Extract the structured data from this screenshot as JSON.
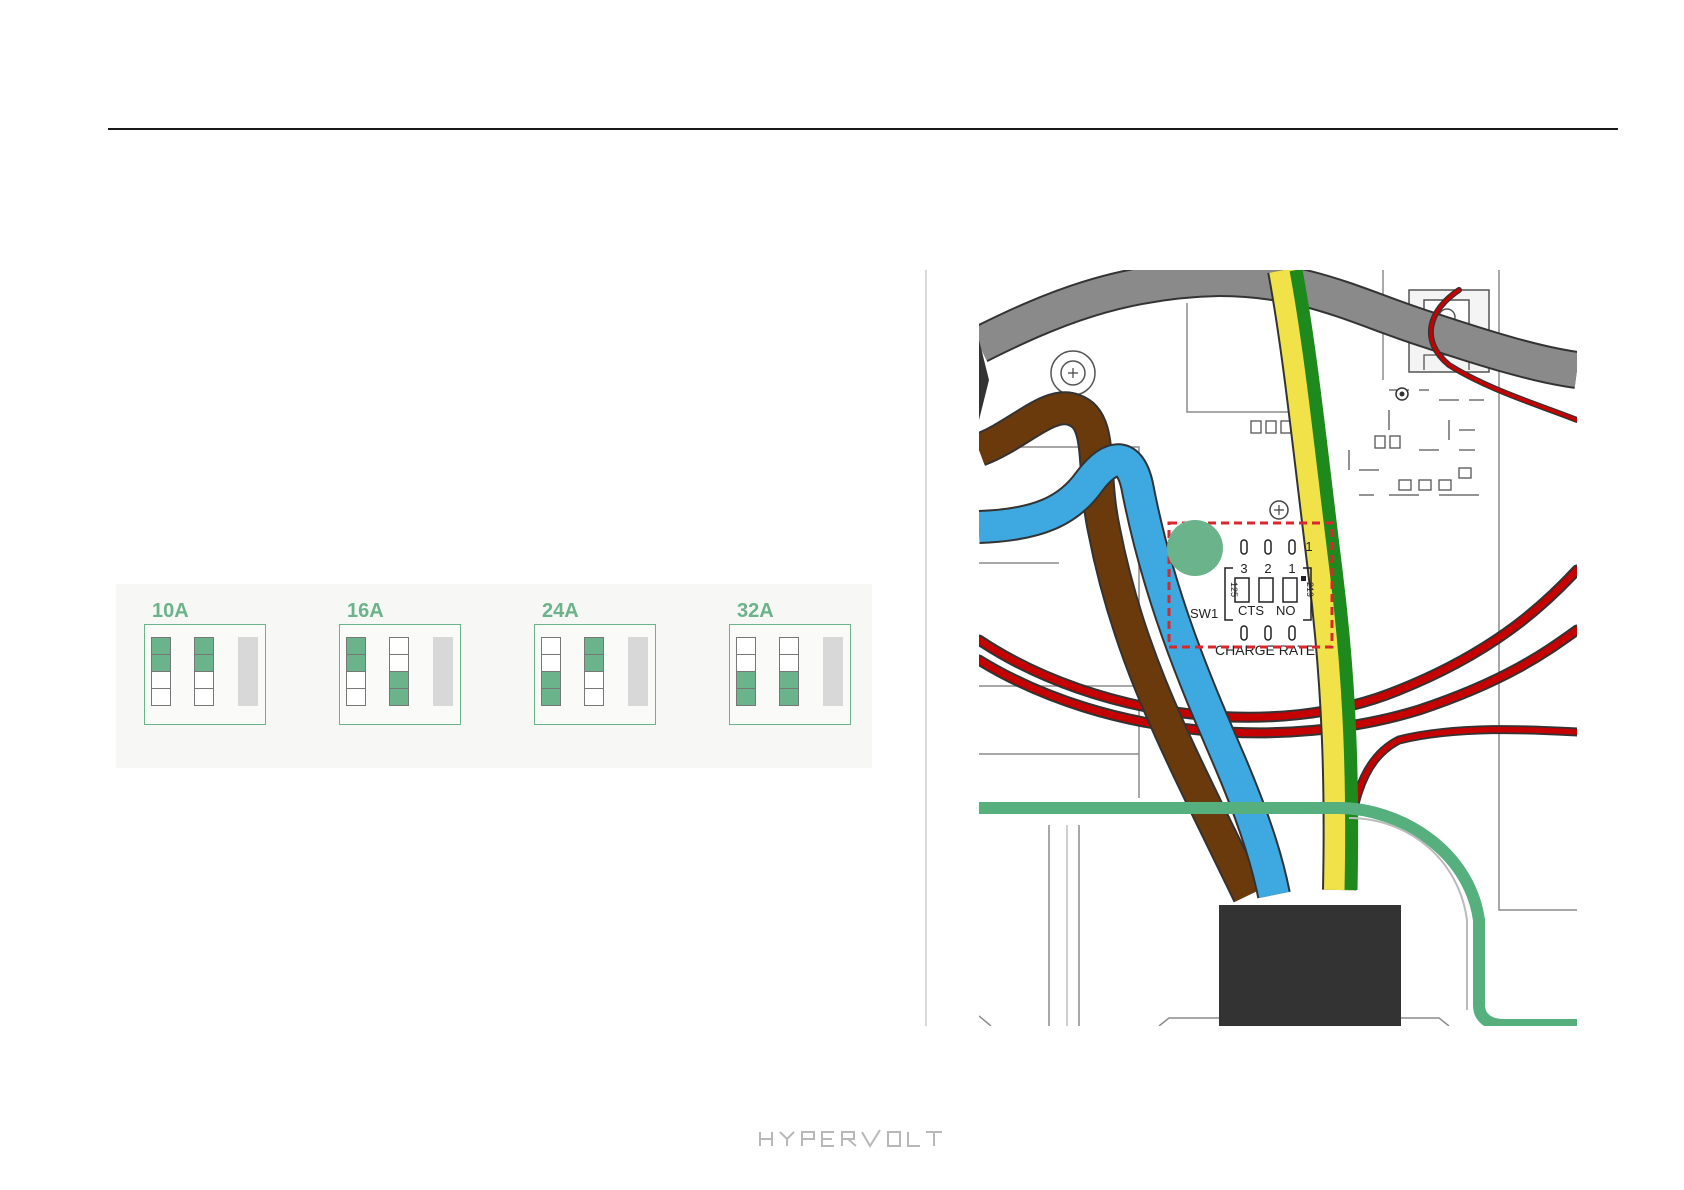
{
  "brand": "HYPERVOLT",
  "charge_rate_panel": {
    "settings": [
      {
        "label": "10A",
        "switches": [
          "up",
          "up",
          "disabled"
        ]
      },
      {
        "label": "16A",
        "switches": [
          "up",
          "down",
          "disabled"
        ]
      },
      {
        "label": "24A",
        "switches": [
          "down",
          "up",
          "disabled"
        ]
      },
      {
        "label": "32A",
        "switches": [
          "down",
          "down",
          "disabled"
        ]
      }
    ]
  },
  "board_diagram": {
    "switch_id": "SW1",
    "positions": [
      "3",
      "2",
      "1"
    ],
    "position_one_label": "1",
    "ratings": [
      "125",
      "219"
    ],
    "switch_labels": [
      "CTS",
      "NO"
    ],
    "caption": "CHARGE RATE"
  },
  "colors": {
    "accent_green": "#6bb38a",
    "highlight_dash": "#d9272e",
    "wire_brown": "#6b3a0c",
    "wire_blue": "#3ea9e0",
    "wire_earth_yellow": "#f2e24a",
    "wire_earth_green": "#1e8a1e",
    "wire_red": "#c40000",
    "cable_grey": "#8a8a8a",
    "gland_black": "#333333"
  }
}
